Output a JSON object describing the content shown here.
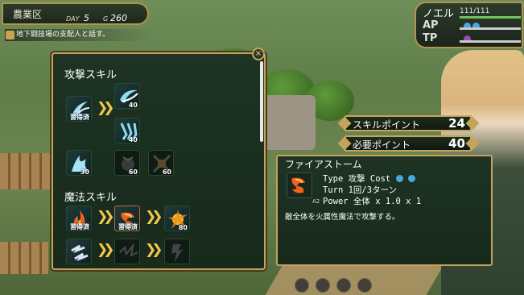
{
  "hud": {
    "area": "農業区",
    "day_label": "DAY",
    "day_value": "5",
    "gold_label": "G",
    "gold_value": "260",
    "quest": "地下闘技場の支配人と話す。"
  },
  "party": {
    "name": "ノエル",
    "hp": "111/111",
    "ap_label": "AP",
    "tp_label": "TP",
    "ap_orb_colors": [
      "#4aa8e0",
      "#4aa8e0"
    ],
    "tp_orb_colors": [
      "#9a4ab8"
    ]
  },
  "tree": {
    "close_label": "×",
    "attack_heading": "攻撃スキル",
    "magic_heading": "魔法スキル",
    "acquired_label": "習得済",
    "attack_skills": [
      {
        "id": "a1",
        "state": "acquired",
        "color": "#a8e4f4"
      },
      {
        "id": "a2",
        "state": "available",
        "cost": "40",
        "color": "#8fdcf0"
      },
      {
        "id": "a3",
        "state": "available",
        "cost": "40",
        "color": "#8fdcf0"
      },
      {
        "id": "a4",
        "state": "available",
        "cost": "30",
        "color": "#a8e4f4"
      },
      {
        "id": "a5",
        "state": "locked",
        "cost": "60",
        "color": "#555"
      },
      {
        "id": "a6",
        "state": "locked",
        "cost": "60",
        "color": "#555"
      }
    ],
    "magic_skills": [
      {
        "id": "m1",
        "state": "acquired",
        "color": "#f06020"
      },
      {
        "id": "m2",
        "state": "acquired",
        "color": "#f06020"
      },
      {
        "id": "m3",
        "state": "available",
        "cost": "80",
        "color": "#f4c020"
      },
      {
        "id": "m4",
        "state": "available",
        "color": "#dde4f4"
      },
      {
        "id": "m5",
        "state": "locked",
        "color": "#555"
      },
      {
        "id": "m6",
        "state": "locked",
        "color": "#555"
      }
    ]
  },
  "points": {
    "skill_label": "スキルポイント",
    "skill_value": "24",
    "need_label": "必要ポイント",
    "need_value": "40"
  },
  "detail": {
    "name": "ファイアストーム",
    "level": "A2",
    "type_line": "Type 攻撃 Cost",
    "cost_orb_colors": [
      "#4aa8e0",
      "#4aa8e0"
    ],
    "turn_line": "Turn 1回/3ターン",
    "power_line": "Power 全体 x 1.0 x 1",
    "description": "敵全体を火属性魔法で攻撃する。"
  }
}
